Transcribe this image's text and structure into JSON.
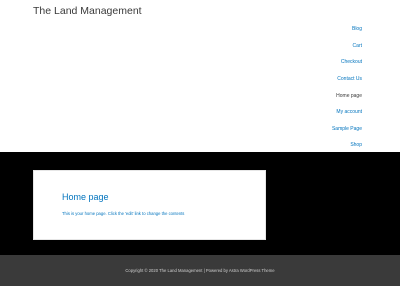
{
  "header": {
    "site_title": "The Land Management"
  },
  "nav": {
    "items": [
      {
        "label": "Blog"
      },
      {
        "label": "Cart"
      },
      {
        "label": "Checkout"
      },
      {
        "label": "Contact Us"
      },
      {
        "label": "Home page",
        "current": true
      },
      {
        "label": "My account"
      },
      {
        "label": "Sample Page"
      },
      {
        "label": "Shop"
      }
    ]
  },
  "main": {
    "page_title": "Home page",
    "body_text": "This is your home page. Click the 'edit' link to change the contents"
  },
  "footer": {
    "text": "Copyright © 2020 The Land Management | Powered by Astra WordPress Theme"
  },
  "colors": {
    "link": "#0274be",
    "text": "#3a3a3a",
    "main_bg": "#000000",
    "footer_bg": "#3a3a3a"
  }
}
